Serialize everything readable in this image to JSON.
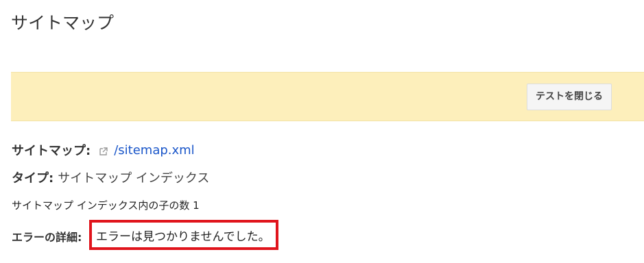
{
  "header": {
    "title": "サイトマップ"
  },
  "banner": {
    "close_button_label": "テストを閉じる"
  },
  "details": {
    "sitemap_label": "サイトマップ:",
    "sitemap_link": "/sitemap.xml",
    "type_label": "タイプ:",
    "type_value": "サイトマップ インデックス",
    "child_count_text": "サイトマップ インデックス内の子の数 1",
    "error_label": "エラーの詳細:",
    "error_value": "エラーは見つかりませんでした。"
  },
  "colors": {
    "banner_background": "#fdefbb",
    "link": "#1a56c9",
    "highlight_border": "#e0141c"
  },
  "icons": {
    "external_link": "external-link-icon"
  }
}
